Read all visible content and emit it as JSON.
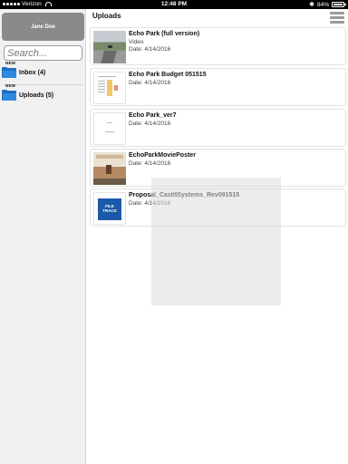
{
  "status_bar": {
    "carrier": "Verizon",
    "time": "12:48 PM",
    "battery": "84%"
  },
  "sidebar": {
    "user_name": "Jane Doe",
    "search_placeholder": "Search...",
    "items": [
      {
        "label": "Inbox (4)",
        "badge": "NEW",
        "icon": "folder-icon"
      },
      {
        "label": "Uploads (5)",
        "badge": "NEW",
        "icon": "folder-icon"
      }
    ]
  },
  "main": {
    "title": "Uploads",
    "files": [
      {
        "title": "Echo Park (full version)",
        "type": "Video",
        "date": "Date: 4/14/2016",
        "thumb": "video-thumbnail"
      },
      {
        "title": "Echo Park Budget 051515",
        "date": "Date: 4/14/2016",
        "thumb": "spreadsheet-thumbnail"
      },
      {
        "title": "Echo Park_ver7",
        "date": "Date: 4/14/2016",
        "thumb": "document-thumbnail"
      },
      {
        "title": "EchoParkMoviePoster",
        "date": "Date: 4/14/2016",
        "thumb": "poster-thumbnail"
      },
      {
        "title": "Proposal_CastItSystems_Rev091515",
        "date": "Date: 4/14/2016",
        "thumb": "proposal-thumbnail",
        "thumb_text": "FILE TRACK"
      }
    ]
  },
  "colors": {
    "accent": "#2f8ae0",
    "sidebar_bg": "#f1f1f1",
    "header_bg": "#8a8a8a"
  }
}
